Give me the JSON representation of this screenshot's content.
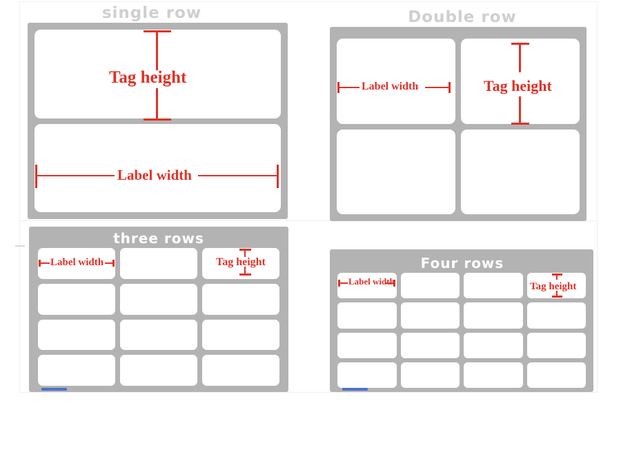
{
  "page": {
    "background": "#ffffff",
    "panel_color": "#b3b3b3",
    "cell_color": "#ffffff",
    "annotation_color": "#e03127",
    "title_outside_color": "#cfcfcf",
    "title_inside_color": "#ffffff",
    "accent_blue": "#4a74c9"
  },
  "annotations": {
    "tag_height": "Tag height",
    "label_width": "Label width"
  },
  "panels": [
    {
      "id": "single-row",
      "title": "single row",
      "title_placement": "outside",
      "columns": 1,
      "rows": 2,
      "annotated_cells": [
        {
          "index": 0,
          "annotation": "Tag height",
          "type": "vertical"
        },
        {
          "index": 1,
          "annotation": "Label width",
          "type": "horizontal"
        }
      ]
    },
    {
      "id": "double-row",
      "title": "Double row",
      "title_placement": "outside",
      "columns": 2,
      "rows": 2,
      "annotated_cells": [
        {
          "index": 0,
          "annotation": "Label width",
          "type": "horizontal"
        },
        {
          "index": 1,
          "annotation": "Tag height",
          "type": "vertical"
        }
      ]
    },
    {
      "id": "three-rows",
      "title": "three rows",
      "title_placement": "inside",
      "columns": 3,
      "rows": 4,
      "annotated_cells": [
        {
          "index": 0,
          "annotation": "Label width",
          "type": "horizontal"
        },
        {
          "index": 2,
          "annotation": "Tag height",
          "type": "vertical"
        }
      ]
    },
    {
      "id": "four-rows",
      "title": "Four rows",
      "title_placement": "inside",
      "columns": 4,
      "rows": 4,
      "annotated_cells": [
        {
          "index": 0,
          "annotation": "Label width",
          "type": "horizontal"
        },
        {
          "index": 3,
          "annotation": "Tag height",
          "type": "vertical"
        }
      ]
    }
  ]
}
